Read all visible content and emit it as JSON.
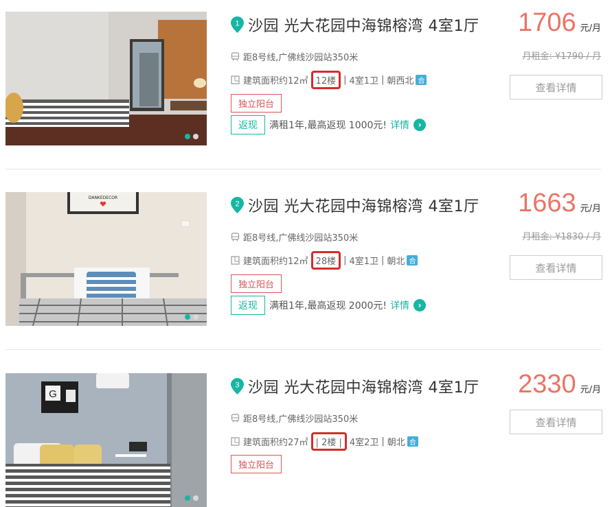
{
  "listings": [
    {
      "index": "1",
      "title": "沙园 光大花园中海锦榕湾 4室1厅",
      "metro": "距8号线,广佛线沙园站350米",
      "area": "建筑面积约12㎡",
      "floor": "12楼",
      "layout": "4室1卫",
      "orientation": "朝西北",
      "shared_badge": "合",
      "tag": "独立阳台",
      "promo_badge": "返现",
      "promo_text": "满租1年,最高返现 1000元!",
      "promo_link": "详情",
      "price": "1706",
      "price_unit": "元/月",
      "original_price": "月租金: ¥1790 / 月",
      "button": "查看详情"
    },
    {
      "index": "2",
      "title": "沙园 光大花园中海锦榕湾 4室1厅",
      "metro": "距8号线,广佛线沙园站350米",
      "area": "建筑面积约12㎡",
      "floor": "28楼",
      "layout": "4室1卫",
      "orientation": "朝北",
      "shared_badge": "合",
      "tag": "独立阳台",
      "promo_badge": "返现",
      "promo_text": "满租1年,最高返现 2000元!",
      "promo_link": "详情",
      "price": "1663",
      "price_unit": "元/月",
      "original_price": "月租金: ¥1830 / 月",
      "button": "查看详情"
    },
    {
      "index": "3",
      "title": "沙园 光大花园中海锦榕湾 4室1厅",
      "metro": "距8号线,广佛线沙园站350米",
      "area": "建筑面积约27㎡",
      "floor": "2楼",
      "layout": "4室2卫",
      "orientation": "朝北",
      "shared_badge": "合",
      "tag": "独立阳台",
      "price": "2330",
      "price_unit": "元/月",
      "button": "查看详情"
    }
  ],
  "colors": {
    "accent_teal": "#17b6a4",
    "price_orange": "#ea7464",
    "tag_red": "#d65554",
    "highlight_red": "#d52b2b",
    "shared_blue": "#44aed9"
  }
}
